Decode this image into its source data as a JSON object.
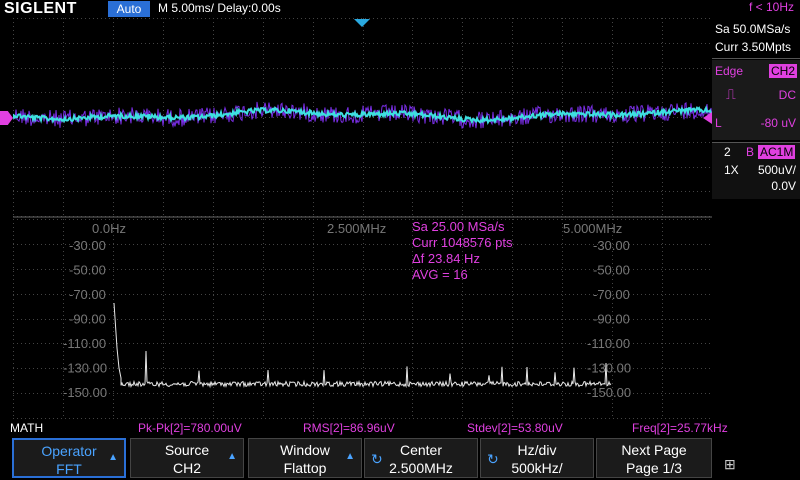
{
  "topbar": {
    "brand": "SIGLENT",
    "mode": "Auto",
    "timebase": "M 5.00ms/ Delay:0.00s",
    "freq": "f < 10Hz"
  },
  "right_panel": {
    "sa": "Sa 50.0MSa/s",
    "curr": "Curr 3.50Mpts",
    "trigger_type": "Edge",
    "trigger_source": "CH2",
    "trigger_coupling": "DC",
    "trigger_level_label": "L",
    "trigger_level": "-80 uV",
    "ch_num": "2",
    "ch_bw": "B",
    "ch_coupling": "AC1M",
    "probe": "1X",
    "vdiv": "500uV/",
    "offset": "0.0V"
  },
  "fft_info": {
    "freq_labels": [
      "0.0Hz",
      "2.500MHz",
      "5.000MHz"
    ],
    "db_labels": [
      "-30.00",
      "-50.00",
      "-70.00",
      "-90.00",
      "-110.00",
      "-130.00",
      "-150.00"
    ],
    "sa": "Sa 25.00 MSa/s",
    "curr": "Curr 1048576 pts",
    "df": "Δf 23.84 Hz",
    "avg": "AVG = 16"
  },
  "measurements": {
    "label": "MATH",
    "pkpk": "Pk-Pk[2]=780.00uV",
    "rms": "RMS[2]=86.96uV",
    "stdev": "Stdev[2]=53.80uV",
    "freq": "Freq[2]=25.77kHz"
  },
  "softkeys": [
    {
      "title": "Operator",
      "value": "FFT"
    },
    {
      "title": "Source",
      "value": "CH2"
    },
    {
      "title": "Window",
      "value": "Flattop"
    },
    {
      "title": "Center",
      "value": "2.500MHz"
    },
    {
      "title": "Hz/div",
      "value": "500kHz/"
    },
    {
      "title": "Next Page",
      "value": "Page 1/3"
    }
  ],
  "colors": {
    "ch2": "#3ee0e0",
    "ch2_env": "#7a2ee6",
    "math": "#e040e0",
    "fft": "#e8e8e8",
    "accent": "#2a6fd6"
  }
}
